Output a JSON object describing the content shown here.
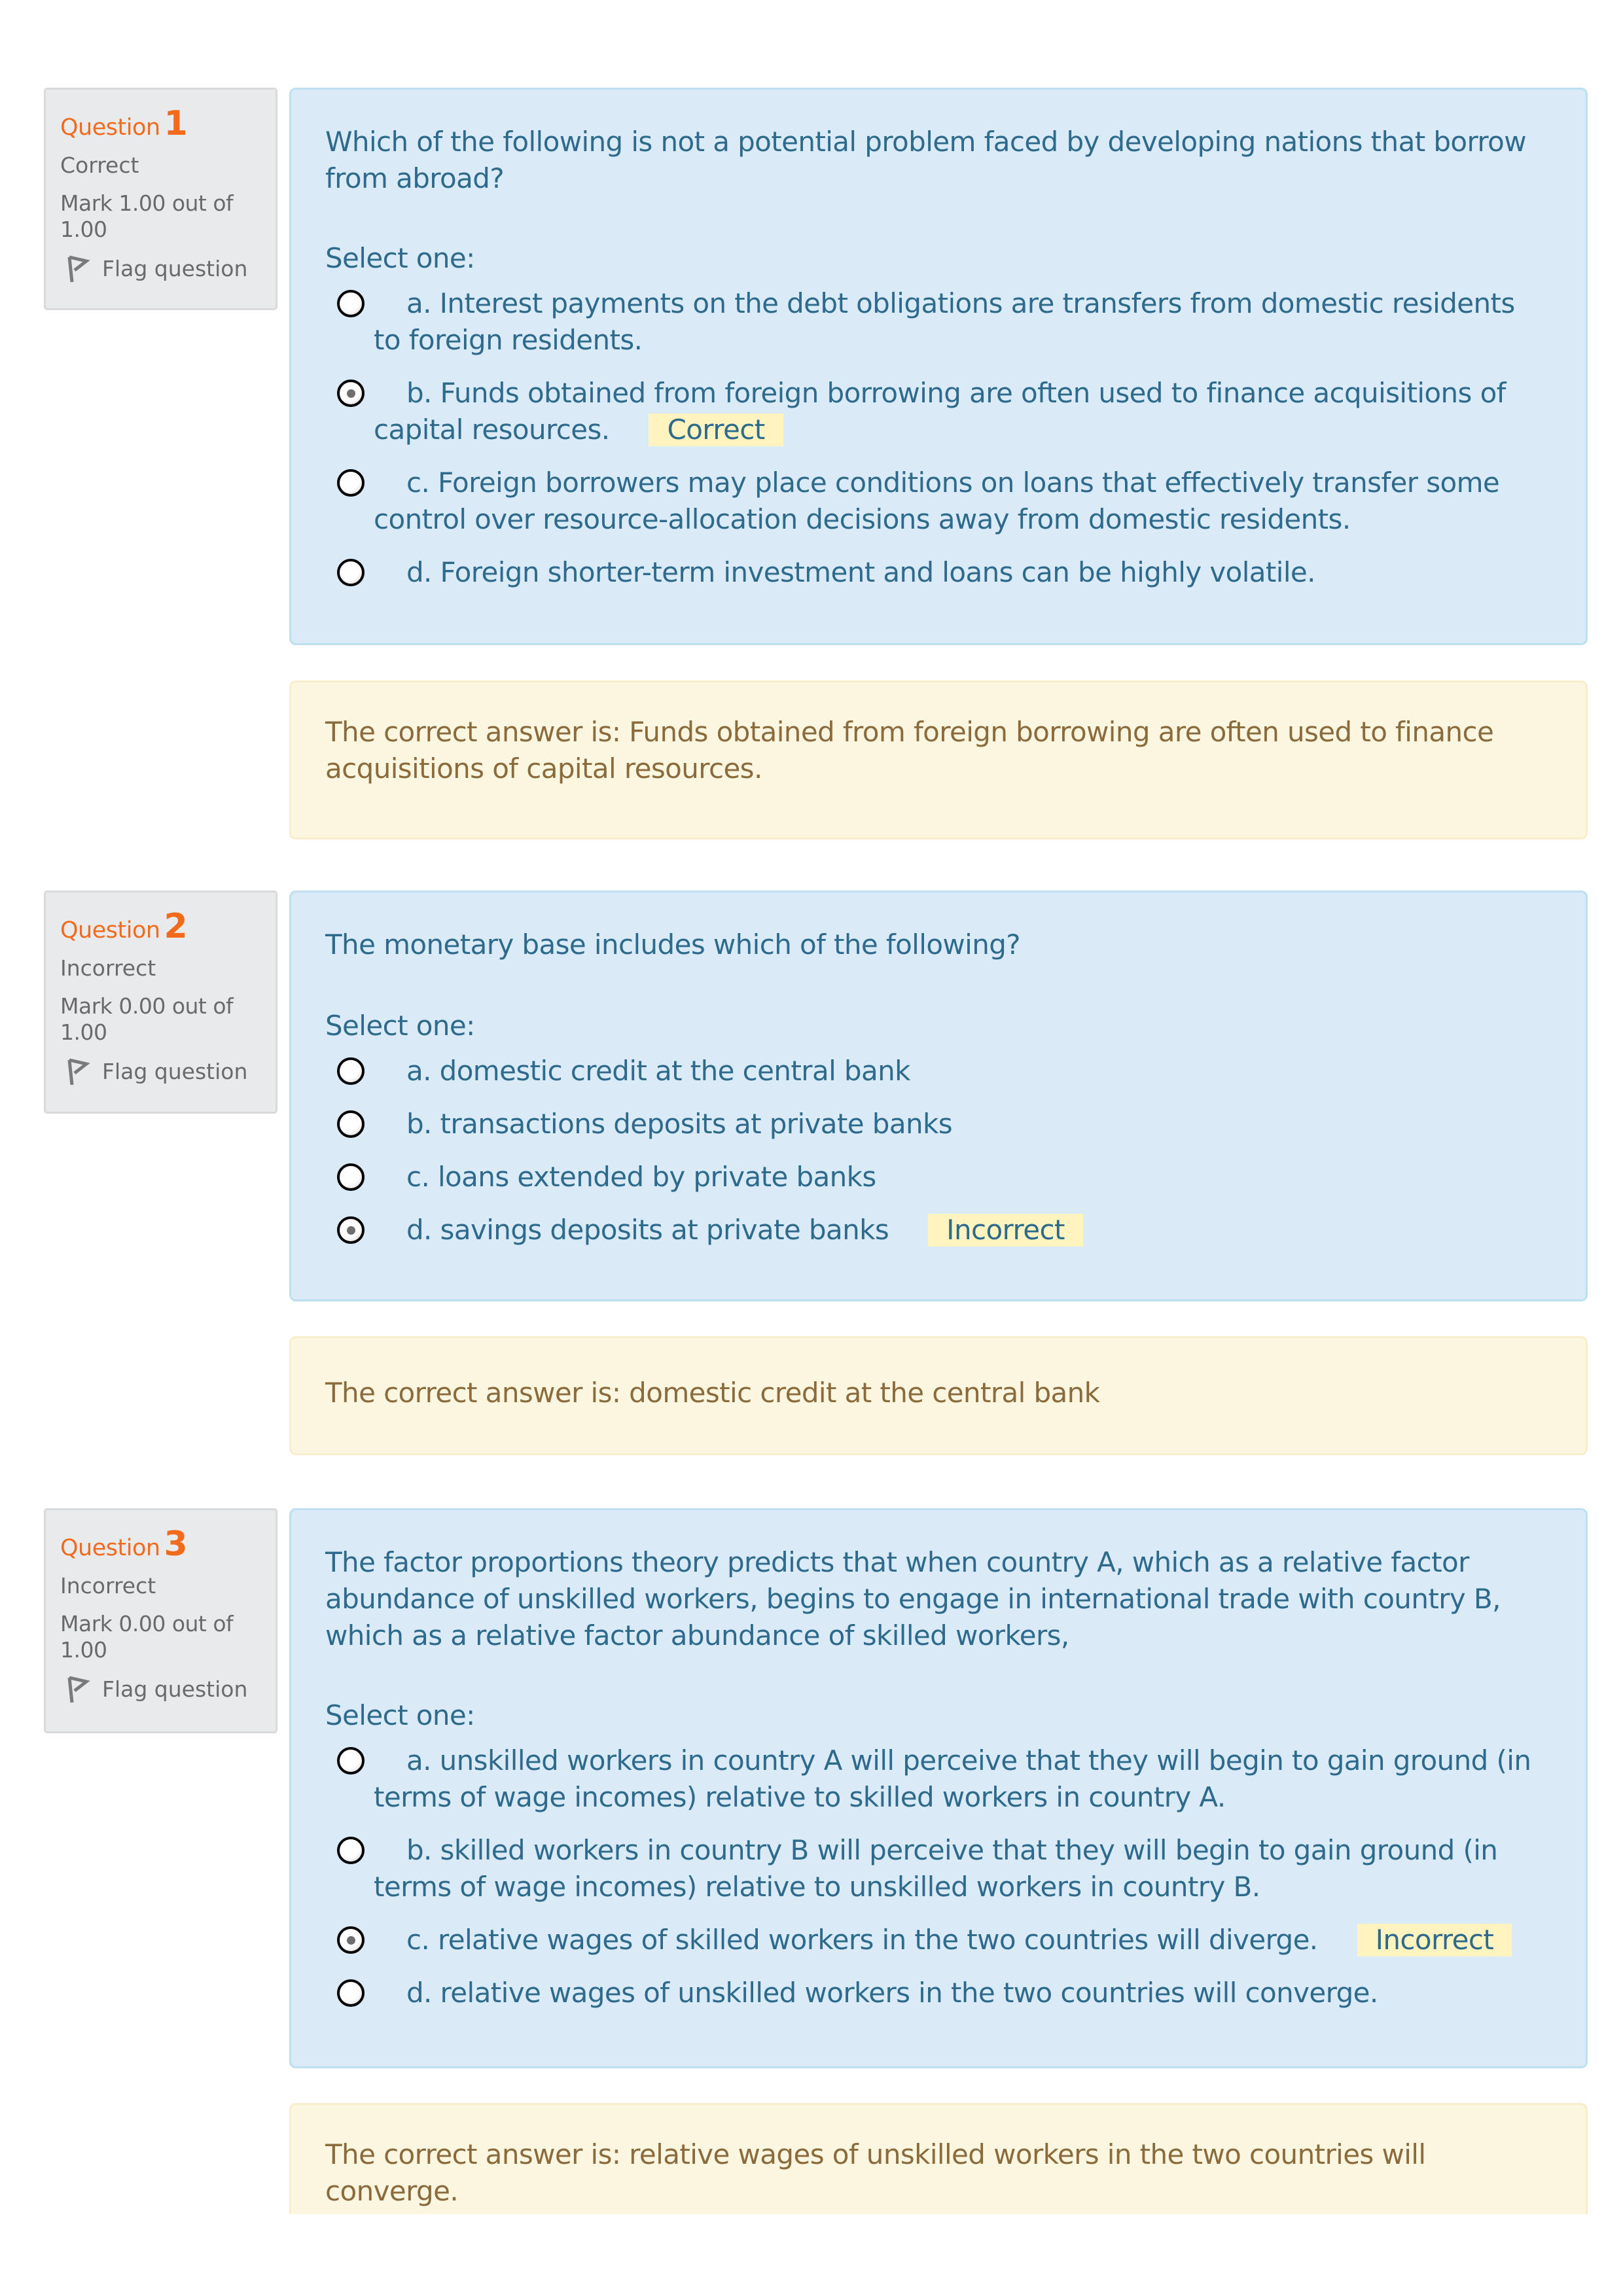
{
  "questions": [
    {
      "label": "Question",
      "number": "1",
      "state": "Correct",
      "grade": "Mark 1.00 out of 1.00",
      "flag_label": "Flag question",
      "text": "Which of the following is not a potential problem faced by developing nations that borrow from abroad?",
      "prompt": "Select one:",
      "options": [
        {
          "text": "a. Interest payments on the debt obligations are transfers from domestic residents to foreign residents.",
          "selected": false,
          "feedback": ""
        },
        {
          "text": "b. Funds obtained from foreign borrowing are often used to finance acquisitions of capital resources.",
          "selected": true,
          "feedback": "Correct"
        },
        {
          "text": "c. Foreign borrowers may place conditions on loans that effectively transfer some control over resource-allocation decisions away from domestic residents.",
          "selected": false,
          "feedback": ""
        },
        {
          "text": "d. Foreign shorter-term investment and loans can be highly volatile.",
          "selected": false,
          "feedback": ""
        }
      ],
      "right_answer": "The correct answer is: Funds obtained from foreign borrowing are often used to finance acquisitions of capital resources."
    },
    {
      "label": "Question",
      "number": "2",
      "state": "Incorrect",
      "grade": "Mark 0.00 out of 1.00",
      "flag_label": "Flag question",
      "text": "The monetary base includes which of the following?",
      "prompt": "Select one:",
      "options": [
        {
          "text": "a. domestic credit at the central bank",
          "selected": false,
          "feedback": ""
        },
        {
          "text": "b. transactions deposits at private banks",
          "selected": false,
          "feedback": ""
        },
        {
          "text": "c. loans extended by private banks",
          "selected": false,
          "feedback": ""
        },
        {
          "text": "d. savings deposits at private banks",
          "selected": true,
          "feedback": "Incorrect"
        }
      ],
      "right_answer": "The correct answer is: domestic credit at the central bank"
    },
    {
      "label": "Question",
      "number": "3",
      "state": "Incorrect",
      "grade": "Mark 0.00 out of 1.00",
      "flag_label": "Flag question",
      "text": "The factor proportions theory predicts that when country A, which as a relative factor abundance of unskilled workers, begins to engage in international trade with country B, which as a relative factor abundance of skilled workers,",
      "prompt": "Select one:",
      "options": [
        {
          "text": "a. unskilled workers in country A will perceive that they will begin to gain ground (in terms of wage incomes) relative to skilled workers in country A.",
          "selected": false,
          "feedback": ""
        },
        {
          "text": "b. skilled workers in country B will perceive that they will begin to gain ground (in terms of wage incomes) relative to unskilled workers in country B.",
          "selected": false,
          "feedback": ""
        },
        {
          "text": "c. relative wages of skilled workers in the two countries will diverge.",
          "selected": true,
          "feedback": "Incorrect"
        },
        {
          "text": "d. relative wages of unskilled workers in the two countries will converge.",
          "selected": false,
          "feedback": ""
        }
      ],
      "right_answer": "The correct answer is: relative wages of unskilled workers in the two countries will converge."
    }
  ],
  "colors": {
    "accent_orange": "#f26b1d",
    "question_text": "#2d6a8c",
    "feedback_text": "#8b6b3c",
    "content_bg": "#daebf7",
    "feedback_bg": "#faf6e0",
    "badge_bg": "#fff3bf",
    "info_bg": "#e9eaec"
  }
}
